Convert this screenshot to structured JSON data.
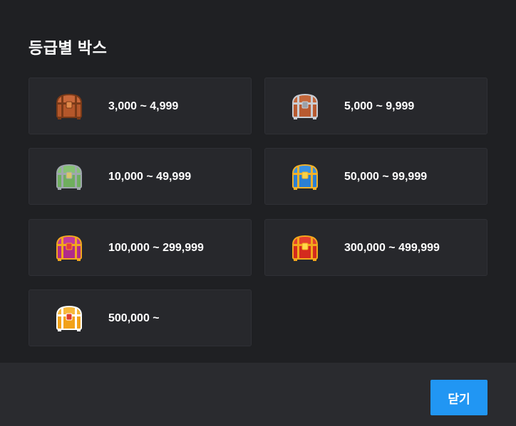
{
  "modal": {
    "title": "등급별 박스",
    "tiers": [
      {
        "range": "3,000 ~ 4,999",
        "icon": "wooden-chest-icon",
        "body": "#b4572a",
        "lid": "#c8683a",
        "trim": "#7a3a18",
        "gem": "#e08a4a"
      },
      {
        "range": "5,000 ~ 9,999",
        "icon": "iron-chest-icon",
        "body": "#b85a30",
        "lid": "#c4673a",
        "trim": "#c9ccd2",
        "gem": "#9aa0a8"
      },
      {
        "range": "10,000 ~ 49,999",
        "icon": "jade-chest-icon",
        "body": "#6fae5e",
        "lid": "#86c274",
        "trim": "#9fa7ad",
        "gem": "#d9c56a"
      },
      {
        "range": "50,000 ~ 99,999",
        "icon": "sapphire-chest-icon",
        "body": "#2a7fd4",
        "lid": "#3a92e2",
        "trim": "#f0b12a",
        "gem": "#f7d24a"
      },
      {
        "range": "100,000 ~ 299,999",
        "icon": "amethyst-chest-icon",
        "body": "#b12a8a",
        "lid": "#c43a9c",
        "trim": "#f2a81e",
        "gem": "#e63a3a"
      },
      {
        "range": "300,000 ~ 499,999",
        "icon": "ruby-chest-icon",
        "body": "#d42a1e",
        "lid": "#e4402e",
        "trim": "#f3a71c",
        "gem": "#ffd94a"
      },
      {
        "range": "500,000 ~",
        "icon": "golden-chest-icon",
        "body": "#f2a218",
        "lid": "#f7b83a",
        "trim": "#ffffff",
        "gem": "#e03a2a"
      }
    ]
  },
  "footer": {
    "close_label": "닫기"
  }
}
